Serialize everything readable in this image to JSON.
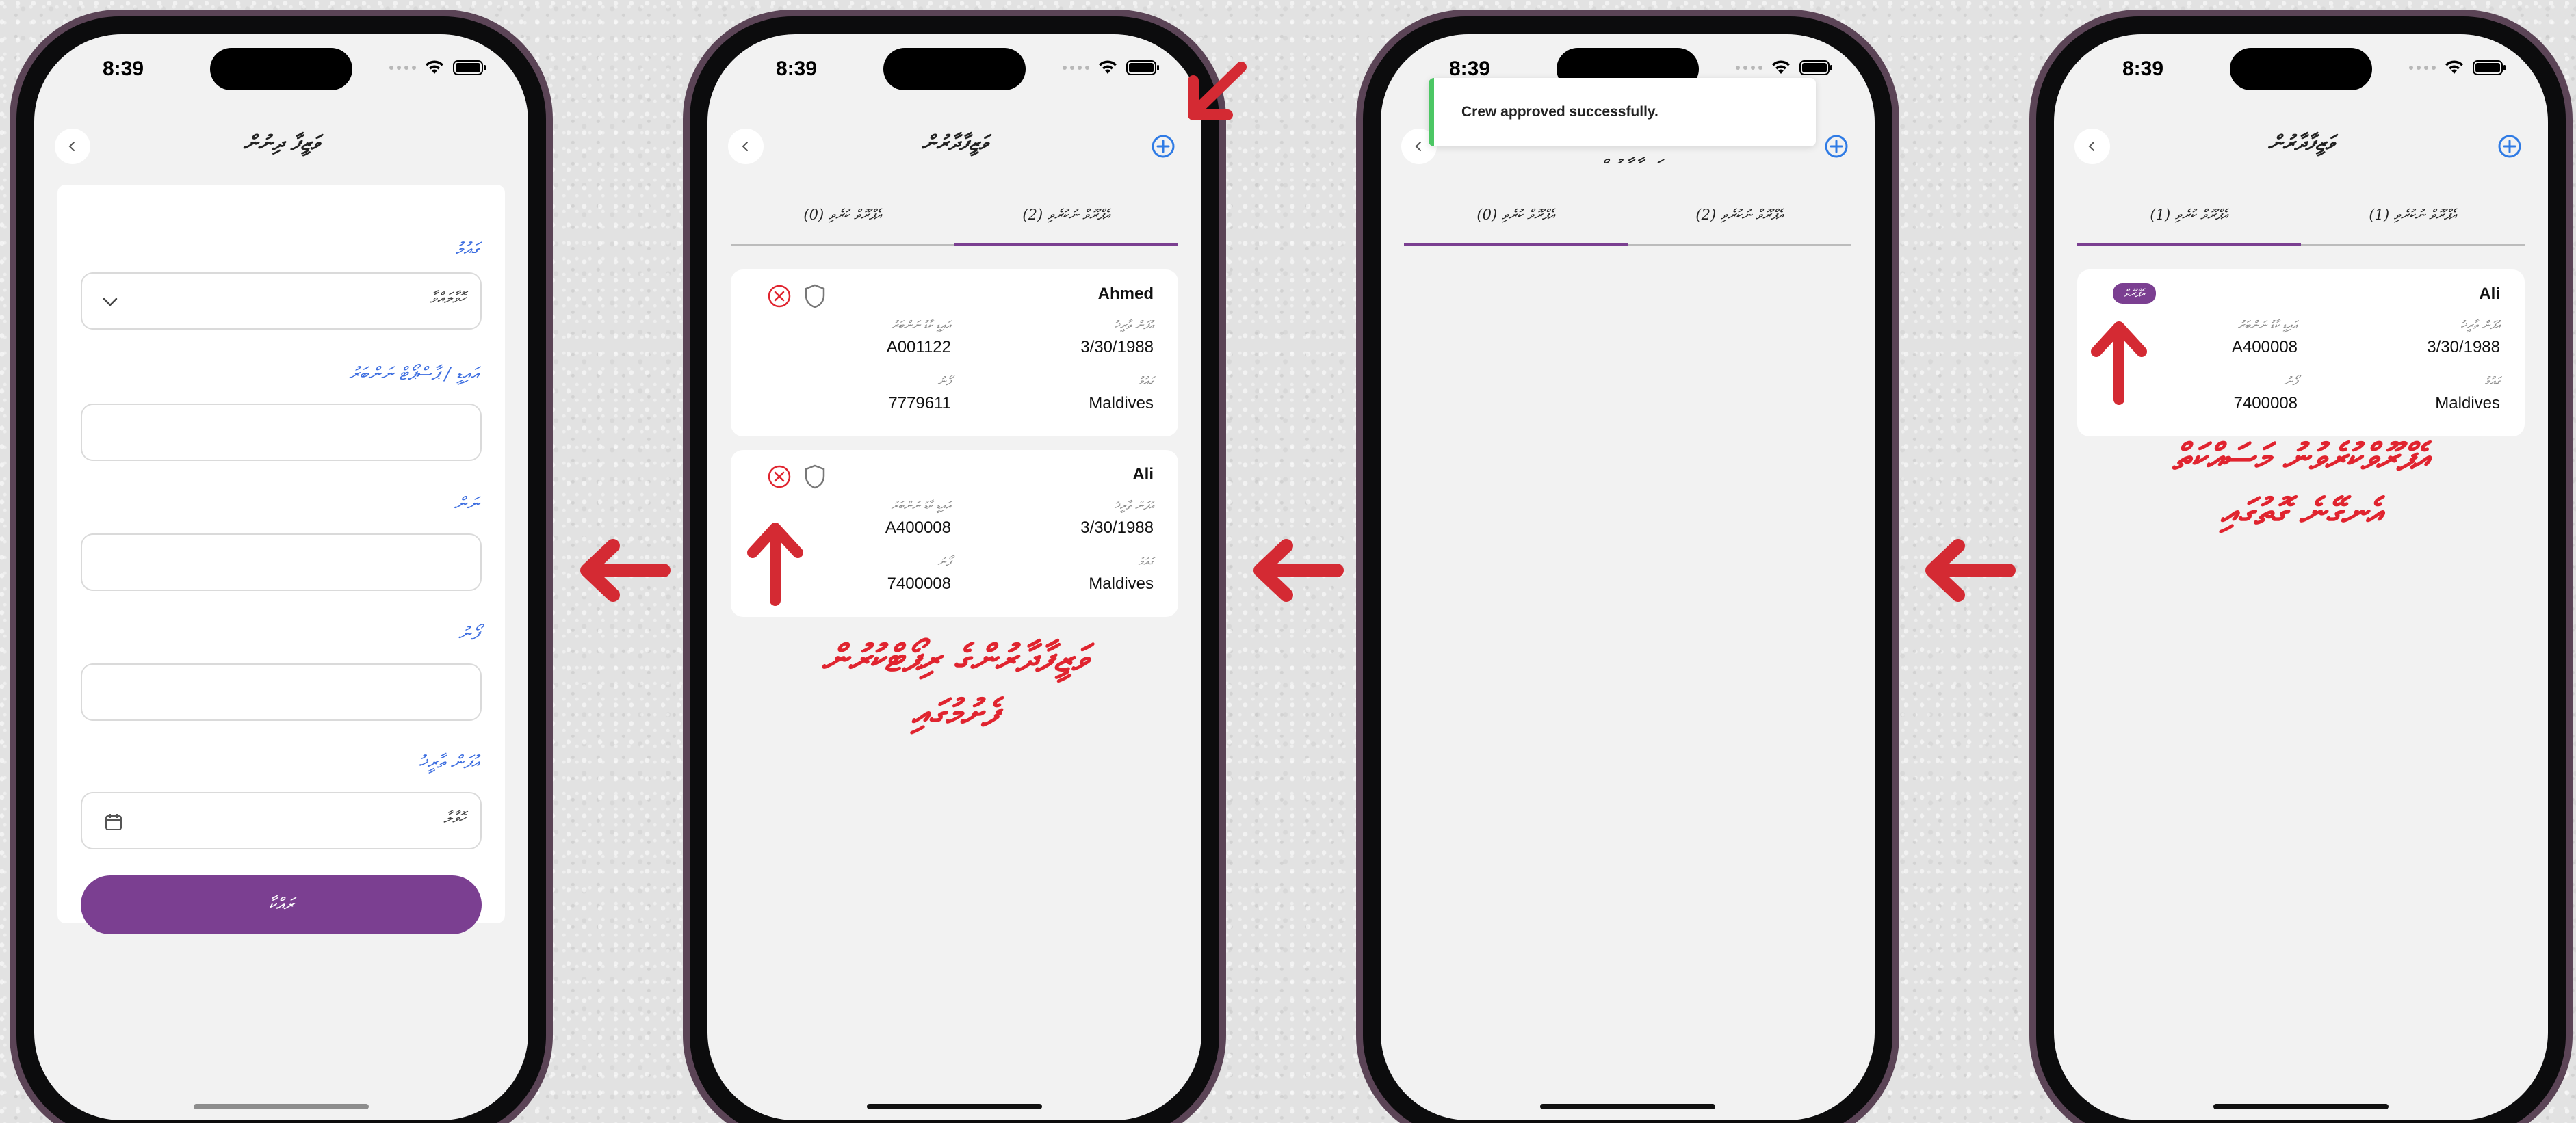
{
  "status_bar": {
    "time": "8:39"
  },
  "colors": {
    "accent": "#7b3f91",
    "link_blue": "#3d6ee0",
    "success": "#4cc764",
    "annotation_red": "#e0242f",
    "phone_frame": "#5b4456"
  },
  "screen1": {
    "title": "ވަޒީފާ ދިނުން",
    "labels": {
      "country": "ގައުމު",
      "id_passport": "އައިޑީ / ޕާސްޕޯޓް ނަންބަރު",
      "name": "ނަން",
      "phone": "ފޯނު",
      "dob": "އުފަން ތާރީޚު"
    },
    "country_placeholder": "ހޮވާލައްވާ",
    "dob_placeholder": "ހޮވާލާ",
    "save_label": "ރައްކާ"
  },
  "screen2": {
    "title": "ވަޒީފާދާރުން",
    "tabs": [
      "އެޕްރޫވް ނުކުރެވި (2)",
      "އެޕްރޫވް ކުރެވި (0)"
    ],
    "cards": [
      {
        "name": "Ahmed",
        "dob_label": "އުފަން ތާރީޚު",
        "dob": "3/30/1988",
        "id_label": "އައިޑީ ކާޑު ނަންބަރު",
        "id": "A001122",
        "country_label": "ގައުމު",
        "country": "Maldives",
        "phone_label": "ފޯނު",
        "phone": "7779611"
      },
      {
        "name": "Ali",
        "dob_label": "އުފަން ތާރީޚު",
        "dob": "3/30/1988",
        "id_label": "އައިޑީ ކާޑު ނަންބަރު",
        "id": "A400008",
        "country_label": "ގައުމު",
        "country": "Maldives",
        "phone_label": "ފޯނު",
        "phone": "7400008"
      }
    ],
    "annotation_line1": "ވަޒީފާދާރުންގެ ރިޕޯޓްކުރުން",
    "annotation_line2": "ފެށުމުގައި"
  },
  "screen3": {
    "toast_message": "Crew approved successfully.",
    "tabs": [
      "އެޕްރޫވް ނުކުރެވި (2)",
      "އެޕްރޫވް ކުރެވި (0)"
    ]
  },
  "screen4": {
    "title": "ވަޒީފާދާރުން",
    "tabs": [
      "އެޕްރޫވް ނުކުރެވި (1)",
      "އެޕްރޫވް ކުރެވި (1)"
    ],
    "card": {
      "name": "Ali",
      "badge": "އެޕްރޫވް",
      "dob_label": "އުފަން ތާރީޚު",
      "dob": "3/30/1988",
      "id_label": "އައިޑީ ކާޑު ނަންބަރު",
      "id": "A400008",
      "country_label": "ގައުމު",
      "country": "Maldives",
      "phone_label": "ފޯނު",
      "phone": "7400008"
    },
    "annotation_line1": "އެޕްރޫވްކުރެވުނު މަސައްކަތް",
    "annotation_line2": "އެނގޭނެ ގޮތުގައި"
  }
}
